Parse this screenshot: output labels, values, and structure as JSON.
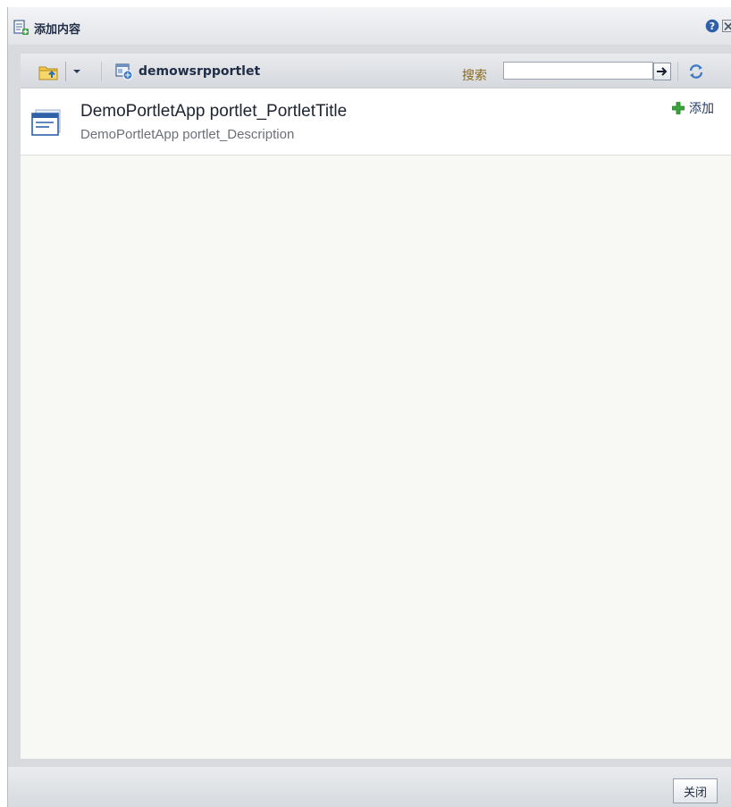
{
  "dialog": {
    "title": "添加内容",
    "icons": {
      "title": "add-content-icon",
      "help": "help-icon",
      "close": "close-icon"
    }
  },
  "toolbar": {
    "folder_icon": "folder-up-icon",
    "dropdown_icon": "chevron-down-icon",
    "breadcrumb": "demowsrpportlet",
    "breadcrumb_icon": "portlet-icon",
    "search_label": "搜索",
    "search_value": "",
    "search_go_icon": "arrow-right-icon",
    "refresh_icon": "refresh-icon"
  },
  "results": [
    {
      "title": "DemoPortletApp portlet_PortletTitle",
      "description": "DemoPortletApp portlet_Description",
      "icon": "portlet-window-icon",
      "add_label": "添加",
      "add_icon": "plus-icon"
    }
  ],
  "footer": {
    "close_label": "关闭"
  },
  "colors": {
    "title_text": "#1f2d47",
    "search_label": "#8a6a1e",
    "add_green": "#3aa53a",
    "content_bg": "#f8f9f4"
  }
}
